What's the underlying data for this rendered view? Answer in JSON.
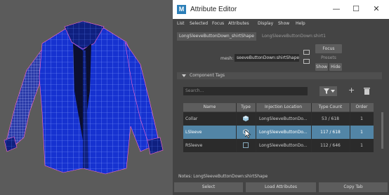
{
  "window": {
    "title": "Attribute Editor",
    "app_icon_letter": "M",
    "minimize": "—",
    "maximize": "☐",
    "close": "✕"
  },
  "menu": [
    "List",
    "Selected",
    "Focus",
    "Attributes",
    "Display",
    "Show",
    "Help"
  ],
  "tabs": [
    "LongSleeveButtonDown_shirtShape",
    "LongSleeveButtonDown:shirt1"
  ],
  "mesh": {
    "label": "mesh:",
    "value": "seeveButtonDown:shirtShape"
  },
  "buttons": {
    "focus": "Focus",
    "presets": "Presets",
    "show": "Show",
    "hide": "Hide"
  },
  "section": {
    "title": "Component Tags"
  },
  "search": {
    "placeholder": "Search..."
  },
  "table": {
    "columns": [
      "Name",
      "Type",
      "Injection Location",
      "Type Count",
      "Order"
    ],
    "rows": [
      {
        "name": "Collar",
        "type_icon": "cube-filled-icon",
        "location": "LongSleeveButtonDo...",
        "count": "53 / 618",
        "order": "1",
        "selected": false
      },
      {
        "name": "LSleeve",
        "type_icon": "cube-outline-icon",
        "location": "LongSleeveButtonDo...",
        "count": "117 / 618",
        "order": "1",
        "selected": true
      },
      {
        "name": "RSleeve",
        "type_icon": "square-outline-icon",
        "location": "LongSleeveButtonDo...",
        "count": "112 / 646",
        "order": "1",
        "selected": false
      }
    ]
  },
  "notes": "Notes:  LongSleeveButtonDown:shirtShape",
  "bottom": {
    "select": "Select",
    "load": "Load Attributes",
    "copy": "Copy Tab"
  },
  "colors": {
    "selected_row": "#5285a6",
    "row_dark": "#2b2b2b",
    "mesh_blue": "#1230c8",
    "wire_light": "#9fb6ff",
    "viewport": "#5b5b5b"
  }
}
